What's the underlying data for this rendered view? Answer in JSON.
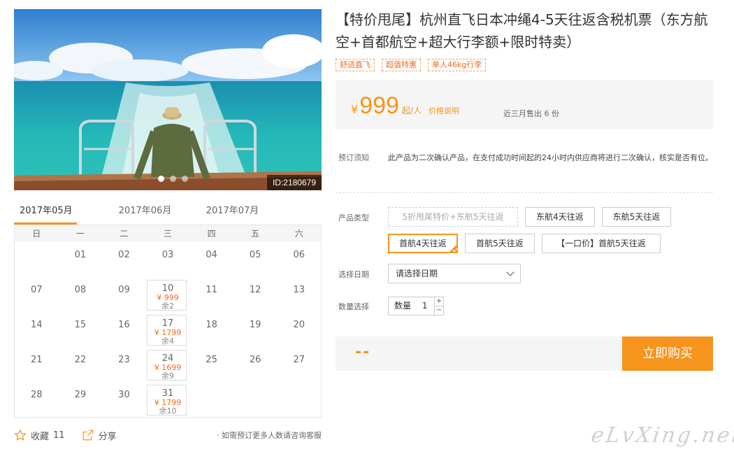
{
  "hero": {
    "image_id": "ID:2180679",
    "slide_count": 3,
    "active_slide": 1
  },
  "calendar": {
    "tabs": [
      "2017年05月",
      "2017年06月",
      "2017年07月"
    ],
    "active_tab": 0,
    "weekdays": [
      "日",
      "一",
      "二",
      "三",
      "四",
      "五",
      "六"
    ],
    "weeks": [
      [
        {
          "d": ""
        },
        {
          "d": "01"
        },
        {
          "d": "02"
        },
        {
          "d": "03"
        },
        {
          "d": "04"
        },
        {
          "d": "05"
        },
        {
          "d": "06"
        }
      ],
      [
        {
          "d": "07"
        },
        {
          "d": "08"
        },
        {
          "d": "09"
        },
        {
          "d": "10",
          "price": "¥ 999",
          "remain": "余2"
        },
        {
          "d": "11"
        },
        {
          "d": "12"
        },
        {
          "d": "13"
        }
      ],
      [
        {
          "d": "14"
        },
        {
          "d": "15"
        },
        {
          "d": "16"
        },
        {
          "d": "17",
          "price": "¥ 1799",
          "remain": "余4"
        },
        {
          "d": "18"
        },
        {
          "d": "19"
        },
        {
          "d": "20"
        }
      ],
      [
        {
          "d": "21"
        },
        {
          "d": "22"
        },
        {
          "d": "23"
        },
        {
          "d": "24",
          "price": "¥ 1699",
          "remain": "余9"
        },
        {
          "d": "25"
        },
        {
          "d": "26"
        },
        {
          "d": "27"
        }
      ],
      [
        {
          "d": "28"
        },
        {
          "d": "29"
        },
        {
          "d": "30"
        },
        {
          "d": "31",
          "price": "¥ 1799",
          "remain": "余10"
        },
        {
          "d": ""
        },
        {
          "d": ""
        },
        {
          "d": ""
        }
      ]
    ]
  },
  "bottom": {
    "favorite_label": "收藏",
    "favorite_count": "11",
    "share_label": "分享",
    "help_text": "· 如需预订更多人数请咨询客服"
  },
  "product": {
    "title": "【特价甩尾】杭州直飞日本冲绳4-5天往返含税机票（东方航空+首都航空+超大行李额+限时特卖）",
    "tags": [
      "舒适直飞",
      "超值特惠",
      "单人46kg行李"
    ],
    "price": {
      "currency": "¥",
      "amount": "999",
      "unit": "起/人",
      "explain_link": "价格说明"
    },
    "sold_text": "近三月售出 6 份",
    "notice_label": "预订须知",
    "notice_text": "此产品为二次确认产品，在支付成功时间起的24小时内供应商将进行二次确认，核实是否有位。"
  },
  "options": {
    "type_label": "产品类型",
    "types": [
      {
        "label": "5折甩尾特价+东航5天往返",
        "state": "disabled"
      },
      {
        "label": "东航4天往返",
        "state": "normal"
      },
      {
        "label": "东航5天往返",
        "state": "normal"
      },
      {
        "label": "首航4天往返",
        "state": "selected"
      },
      {
        "label": "首航5天往返",
        "state": "normal"
      },
      {
        "label": "【一口价】首航5天往返",
        "state": "normal"
      }
    ],
    "date_label": "选择日期",
    "date_placeholder": "请选择日期",
    "qty_label": "数量选择",
    "qty_prefix": "数量",
    "qty_value": "1",
    "qty_plus": "+",
    "qty_minus": "−"
  },
  "buy": {
    "price_display": "--",
    "button_label": "立即购买"
  },
  "watermark": "eLvXing.net",
  "colors": {
    "accent": "#f7941d",
    "price": "#f06b1e"
  }
}
